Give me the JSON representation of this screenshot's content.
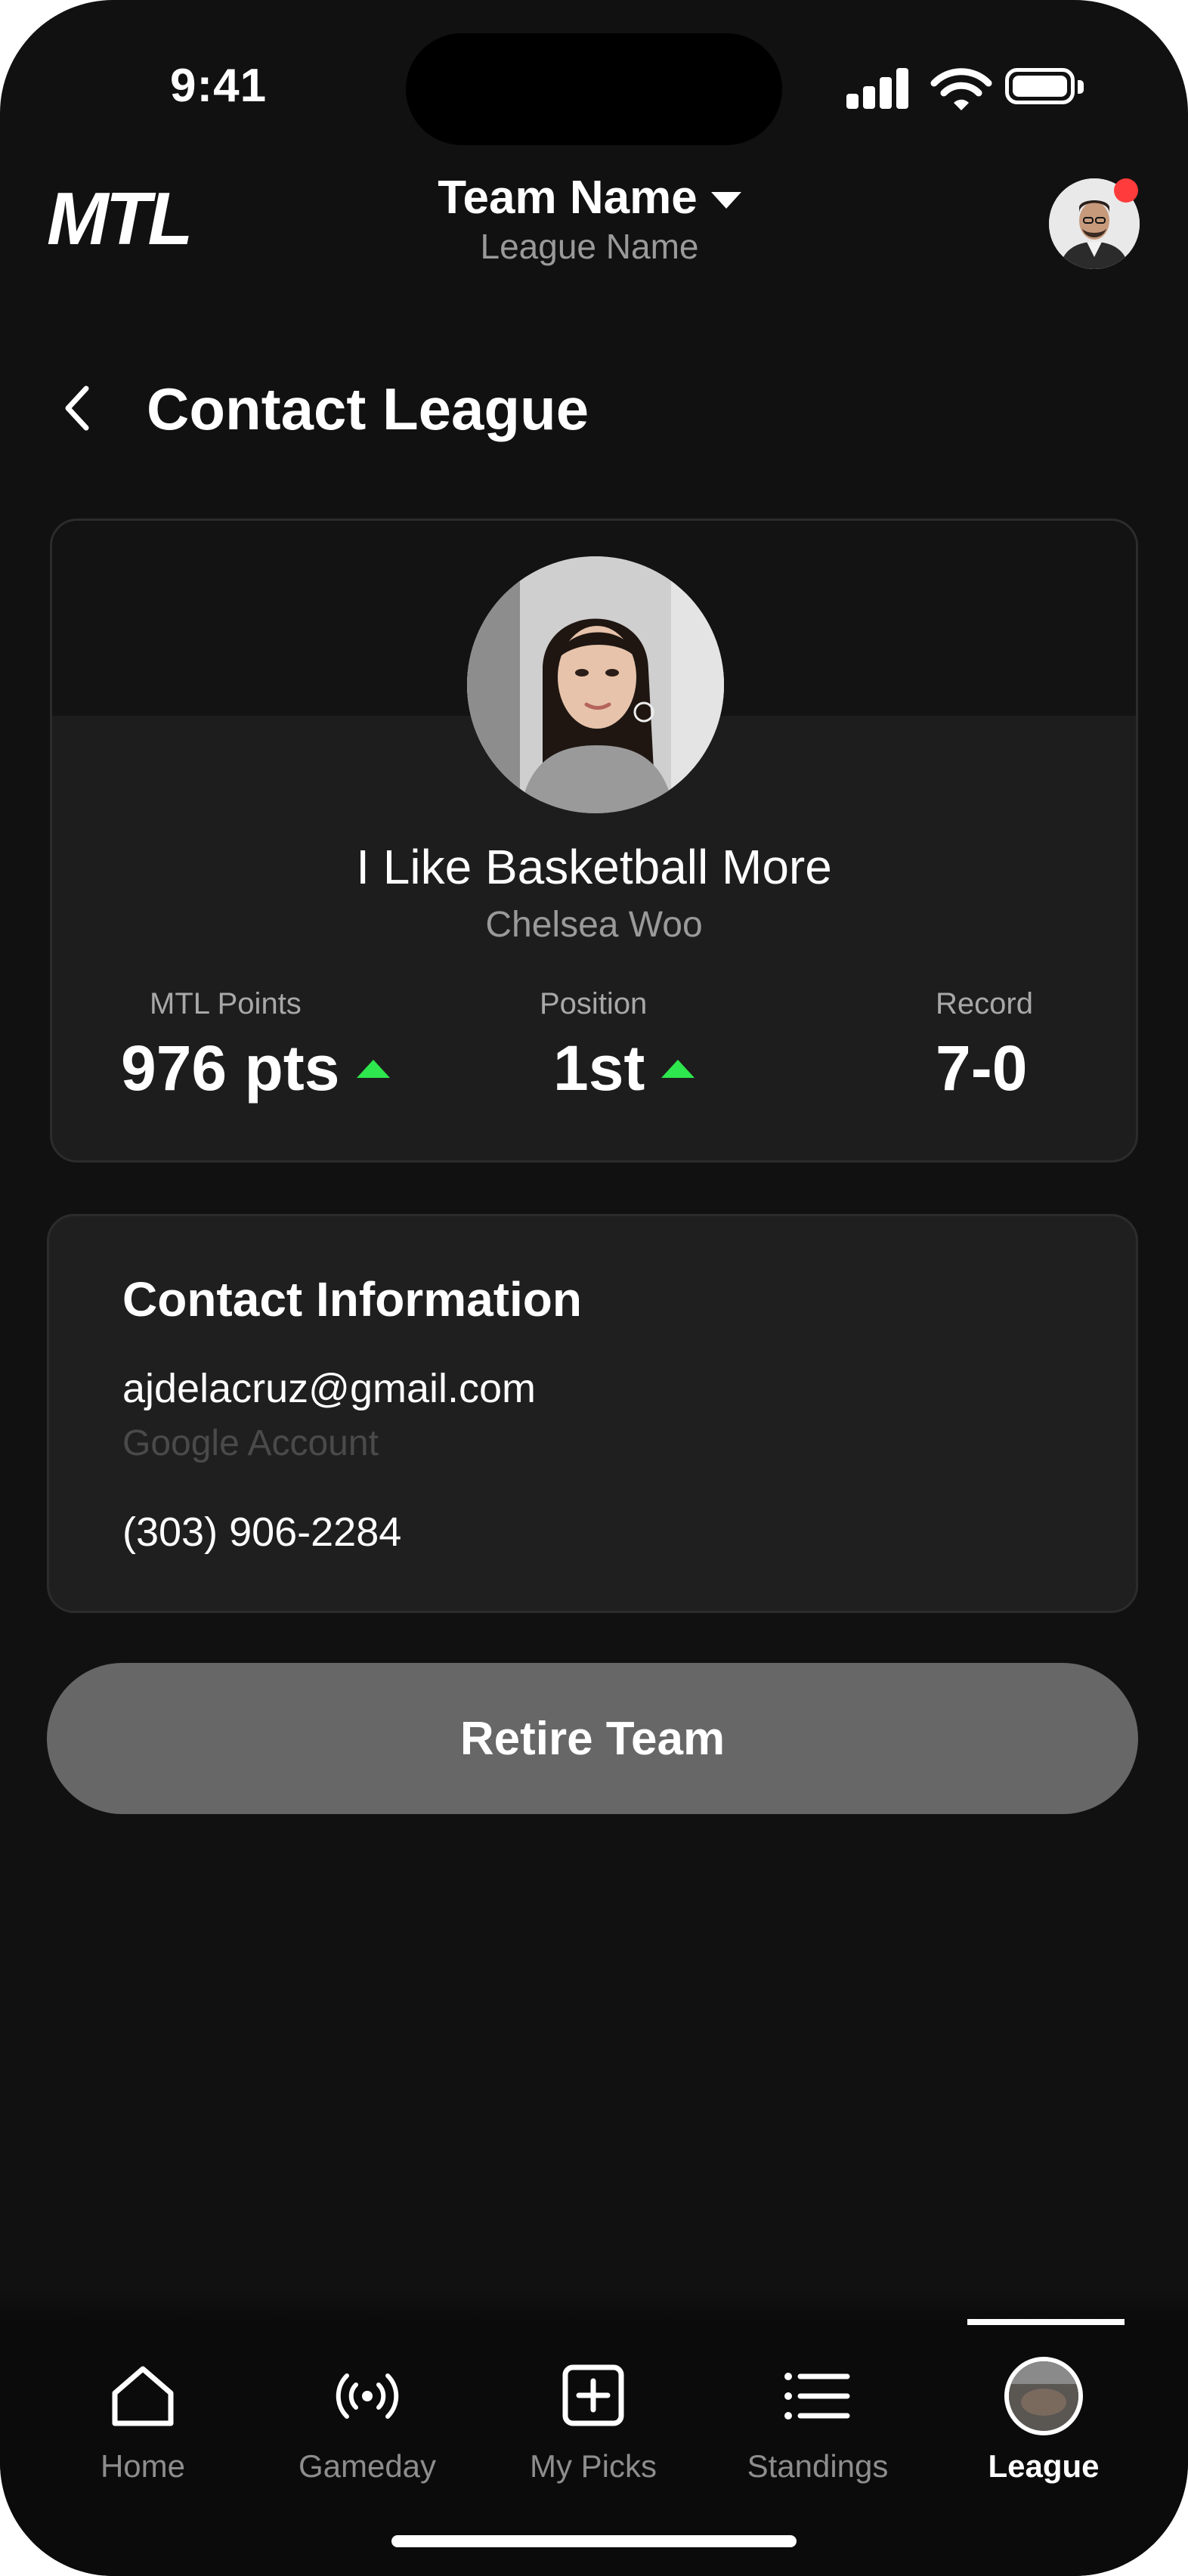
{
  "status_bar": {
    "time": "9:41"
  },
  "header": {
    "logo": "MTL",
    "team_name": "Team Name",
    "league_name": "League Name"
  },
  "page": {
    "title": "Contact League"
  },
  "profile": {
    "team_name": "I Like Basketball More",
    "owner_name": "Chelsea Woo",
    "stats": [
      {
        "label": "MTL Points",
        "value": "976 pts",
        "trend": "up"
      },
      {
        "label": "Position",
        "value": "1st",
        "trend": "up"
      },
      {
        "label": "Record",
        "value": "7-0"
      }
    ]
  },
  "contact": {
    "title": "Contact Information",
    "email": "ajdelacruz@gmail.com",
    "account_type": "Google Account",
    "phone": "(303) 906-2284"
  },
  "actions": {
    "retire_label": "Retire Team"
  },
  "bottom_nav": {
    "items": [
      {
        "label": "Home",
        "icon": "home-icon"
      },
      {
        "label": "Gameday",
        "icon": "broadcast-icon"
      },
      {
        "label": "My Picks",
        "icon": "plus-square-icon"
      },
      {
        "label": "Standings",
        "icon": "list-icon"
      },
      {
        "label": "League",
        "icon": "league-avatar",
        "active": true
      }
    ]
  },
  "colors": {
    "background": "#111111",
    "card": "#1d1d1d",
    "trend_up": "#2ee64d",
    "button": "#676767",
    "notification": "#ff3b3b"
  }
}
